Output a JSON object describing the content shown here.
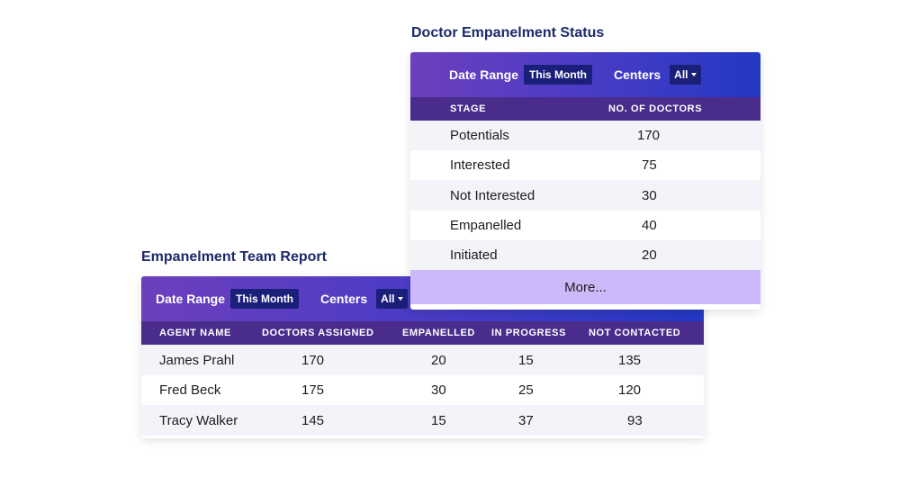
{
  "doctor_status": {
    "title": "Doctor Empanelment Status",
    "filters": {
      "date_range_label": "Date Range",
      "date_range_value": "This Month",
      "centers_label": "Centers",
      "centers_value": "All"
    },
    "columns": [
      "STAGE",
      "NO. OF DOCTORS"
    ],
    "rows": [
      {
        "stage": "Potentials",
        "count": "170"
      },
      {
        "stage": "Interested",
        "count": "75"
      },
      {
        "stage": "Not Interested",
        "count": "30"
      },
      {
        "stage": "Empanelled",
        "count": "40"
      },
      {
        "stage": "Initiated",
        "count": "20"
      }
    ],
    "more_label": "More..."
  },
  "team_report": {
    "title": "Empanelment Team Report",
    "filters": {
      "date_range_label": "Date Range",
      "date_range_value": "This Month",
      "centers_label": "Centers",
      "centers_value": "All"
    },
    "columns": [
      "AGENT NAME",
      "DOCTORS ASSIGNED",
      "EMPANELLED",
      "IN PROGRESS",
      "NOT CONTACTED"
    ],
    "rows": [
      {
        "agent": "James Prahl",
        "assigned": "170",
        "empanelled": "20",
        "in_progress": "15",
        "not_contacted": "135"
      },
      {
        "agent": "Fred Beck",
        "assigned": "175",
        "empanelled": "30",
        "in_progress": "25",
        "not_contacted": "120"
      },
      {
        "agent": "Tracy Walker",
        "assigned": "145",
        "empanelled": "15",
        "in_progress": "37",
        "not_contacted": "93"
      }
    ]
  },
  "colors": {
    "title": "#1b2a6b",
    "header_gradient_start": "#6c3fbd",
    "header_gradient_end": "#2338c4",
    "table_header": "#4a2c8c",
    "pill": "#1a1f7a",
    "more_button": "#cdb8f9",
    "row_alt": "#f3f4f9"
  }
}
